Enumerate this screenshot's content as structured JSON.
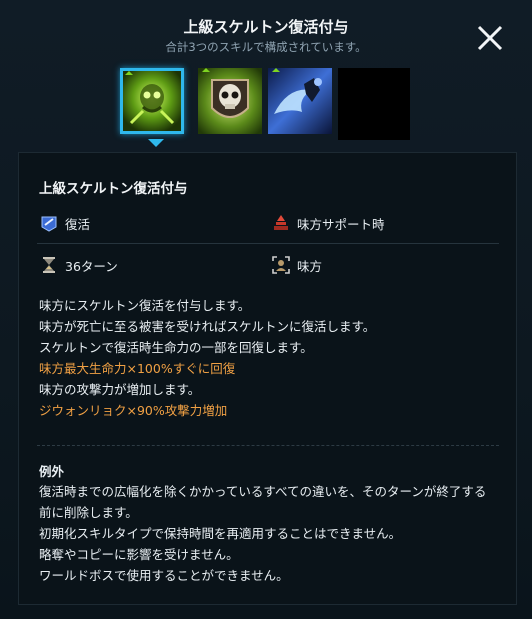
{
  "header": {
    "title": "上級スケルトン復活付与",
    "subtitle": "合計3つのスキルで構成されています。",
    "close_icon": "close-icon"
  },
  "skill_slots": [
    {
      "icon": "green-skeleton-skill-icon",
      "selected": true
    },
    {
      "icon": "skull-shield-skill-icon",
      "selected": false
    },
    {
      "icon": "blue-wave-skill-icon",
      "selected": false
    },
    {
      "icon": "empty-slot",
      "selected": false
    }
  ],
  "detail": {
    "name": "上級スケルトン復活付与",
    "type_label": "復活",
    "trigger_label": "味方サポート時",
    "duration_label": "36ターン",
    "target_label": "味方",
    "description": [
      {
        "text": "味方にスケルトン復活を付与します。",
        "color": "#e8eef2"
      },
      {
        "text": "味方が死亡に至る被害を受ければスケルトンに復活します。",
        "color": "#e8eef2"
      },
      {
        "text": "スケルトンで復活時生命力の一部を回復します。",
        "color": "#e8eef2"
      },
      {
        "text": "味方最大生命力×100%すぐに回復",
        "color": "#f0a044"
      },
      {
        "text": "味方の攻撃力が増加します。",
        "color": "#e8eef2"
      },
      {
        "text": "ジウォンリョク×90%攻撃力増加",
        "color": "#f0a044"
      }
    ],
    "exceptions_title": "例外",
    "exceptions": [
      "復活時までの広幅化を除くかかっているすべての違いを、そのターンが終了する",
      "前に削除します。",
      "初期化スキルタイプで保持時間を再適用することはできません。",
      "略奪やコピーに影響を受けません。",
      "ワールドボスで使用することができません。"
    ]
  },
  "colors": {
    "accent": "#2fb8ec",
    "highlight": "#f0a044",
    "background": "#0d1820"
  }
}
